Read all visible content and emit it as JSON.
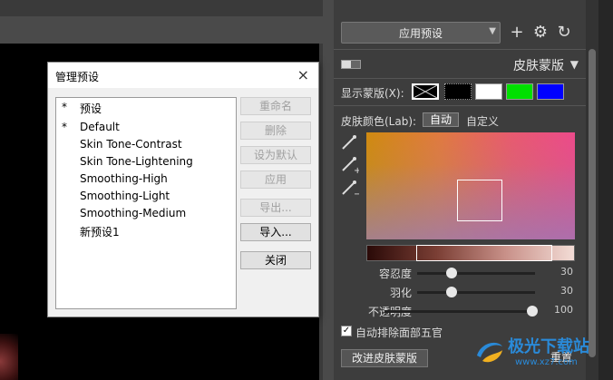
{
  "dialog": {
    "title": "管理预设",
    "close": "×",
    "presets": [
      {
        "star": "*",
        "name": "预设"
      },
      {
        "star": "*",
        "name": "Default"
      },
      {
        "star": "",
        "name": "Skin Tone-Contrast"
      },
      {
        "star": "",
        "name": "Skin Tone-Lightening"
      },
      {
        "star": "",
        "name": "Smoothing-High"
      },
      {
        "star": "",
        "name": "Smoothing-Light"
      },
      {
        "star": "",
        "name": "Smoothing-Medium"
      },
      {
        "star": "",
        "name": "新预设1"
      }
    ],
    "buttons": {
      "rename": "重命名",
      "delete": "删除",
      "set_default": "设为默认",
      "apply": "应用",
      "export": "导出...",
      "import": "导入...",
      "close": "关闭"
    }
  },
  "panel": {
    "preset_dropdown": "应用预设",
    "section_title": "皮肤蒙版",
    "show_mask_label": "显示蒙版(X):",
    "swatch_colors": [
      "#000000",
      "#000000",
      "#ffffff",
      "#00e000",
      "#0000ff"
    ],
    "skin_color_label": "皮肤颜色(Lab):",
    "auto_label": "自动",
    "custom_label": "自定义",
    "sliders": [
      {
        "label": "容忍度",
        "value": "30",
        "pos": 0.3
      },
      {
        "label": "羽化",
        "value": "30",
        "pos": 0.3
      },
      {
        "label": "不透明度",
        "value": "100",
        "pos": 1.0
      }
    ],
    "auto_exclude_label": "自动排除面部五官",
    "refine_button": "改进皮肤蒙版",
    "reset_button": "重置"
  },
  "watermark": {
    "text": "极光下载站",
    "url": "www.xz7.com"
  }
}
